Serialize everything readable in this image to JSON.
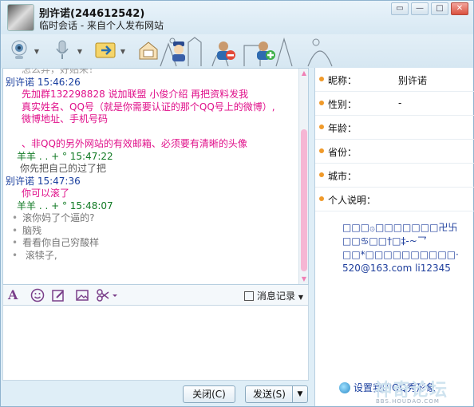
{
  "window": {
    "title_name": "别许诺(244612542)",
    "title_sub": "临时会话 - 来自个人发布网站",
    "buttons": {
      "minimize": "▭",
      "maximize": "—",
      "restore": "□",
      "close": "✕"
    }
  },
  "chat": {
    "lines": [
      {
        "kind": "faded",
        "text": "怎么弄，好贴来！"
      },
      {
        "kind": "hdr-blue",
        "text": "别许诺   15:46:26"
      },
      {
        "kind": "msg-pink",
        "text": "先加群132298828   说加联盟 小俊介绍   再把资料发我"
      },
      {
        "kind": "msg-pink",
        "text": "真实姓名、QQ号（就是你需要认证的那个QQ号上的微博）,"
      },
      {
        "kind": "msg-pink",
        "text": "微博地址、手机号码"
      },
      {
        "kind": "blank",
        "text": ""
      },
      {
        "kind": "msg-pink",
        "text": "、非QQ的另外网站的有效邮箱、必须要有清晰的头像"
      },
      {
        "kind": "hdr-green",
        "text": "羊羊   . . + °   15:47:22"
      },
      {
        "kind": "msg-gray",
        "text": "你先把自己的过了把"
      },
      {
        "kind": "hdr-blue",
        "text": "别许诺   15:47:36"
      },
      {
        "kind": "msg-pink",
        "text": "你可以滚了"
      },
      {
        "kind": "hdr-green",
        "text": "羊羊   . . + °   15:48:07"
      },
      {
        "kind": "bullet",
        "text": "滚你妈了个逼的?"
      },
      {
        "kind": "bullet",
        "text": "脑残"
      },
      {
        "kind": "bullet",
        "text": "看看你自己穷酸样"
      },
      {
        "kind": "bullet",
        "text": " 滚犊子,"
      }
    ]
  },
  "format_toolbar": {
    "history_label": "消息记录"
  },
  "bottom": {
    "close_label": "关闭(C)",
    "send_label": "发送(S)",
    "send_dropdown": "▼"
  },
  "info": {
    "fields": [
      {
        "label": "昵称：",
        "value": "别许诺"
      },
      {
        "label": "性别：",
        "value": "-"
      },
      {
        "label": "年龄：",
        "value": ""
      },
      {
        "label": "省份：",
        "value": ""
      },
      {
        "label": "城市：",
        "value": ""
      },
      {
        "label": "个人说明：",
        "value": ""
      }
    ],
    "signature": [
      "□□□۞□□□□□□□卍卐",
      "□□♋□□†□‡-~乛",
      "□□*□□□□□□□□□□·",
      "520@163.com  li12345"
    ],
    "set_link": "设置我的QQ秀形象"
  },
  "watermark": {
    "main": "神奇论坛",
    "sub": "BBS.HOUDAO.COM"
  }
}
